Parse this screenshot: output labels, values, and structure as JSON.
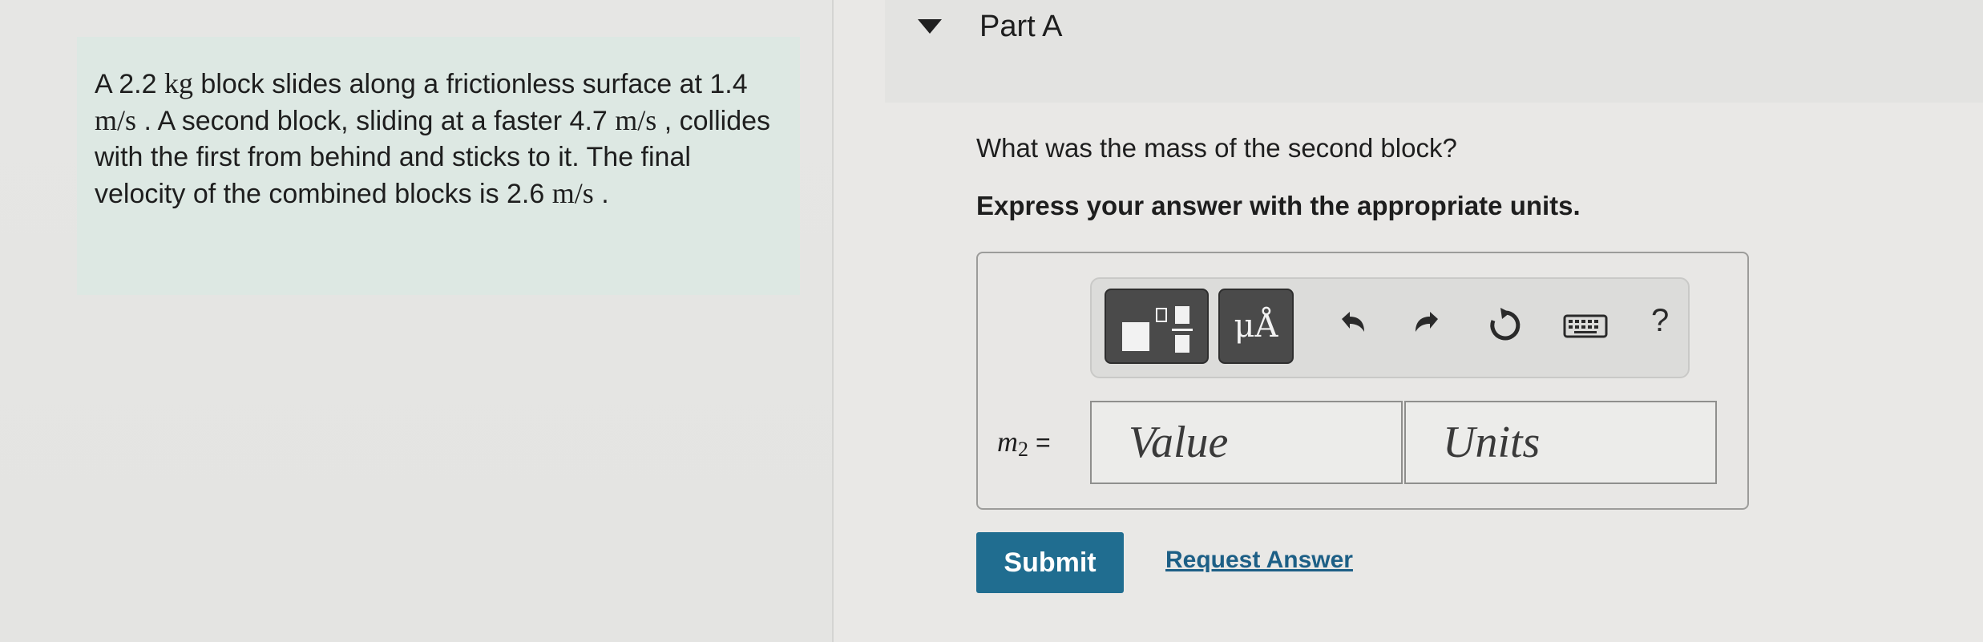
{
  "problem": {
    "segments": [
      {
        "t": "A 2.2 "
      },
      {
        "m": "kg"
      },
      {
        "t": " block slides along a frictionless surface at 1.4 "
      },
      {
        "m": "m/s"
      },
      {
        "t": " . A second block, sliding at a faster 4.7 "
      },
      {
        "m": "m/s"
      },
      {
        "t": " , collides with the first from behind and sticks to it. The final velocity of the combined blocks is 2.6 "
      },
      {
        "m": "m/s"
      },
      {
        "t": " ."
      }
    ]
  },
  "part": {
    "title": "Part A",
    "question": "What was the mass of the second block?",
    "instruction": "Express your answer with the appropriate units."
  },
  "toolbar": {
    "units_label": "μÅ",
    "help_label": "?",
    "icons": [
      "templates-icon",
      "units-icon",
      "undo-icon",
      "redo-icon",
      "reset-icon",
      "keyboard-icon",
      "help-icon"
    ]
  },
  "answer": {
    "variable": "m",
    "subscript": "2",
    "equals": "=",
    "value_placeholder": "Value",
    "units_placeholder": "Units"
  },
  "actions": {
    "submit_label": "Submit",
    "request_label": "Request Answer"
  },
  "colors": {
    "problem_bg": "#dde8e3",
    "submit_bg": "#206d90",
    "link": "#1d5f86"
  }
}
